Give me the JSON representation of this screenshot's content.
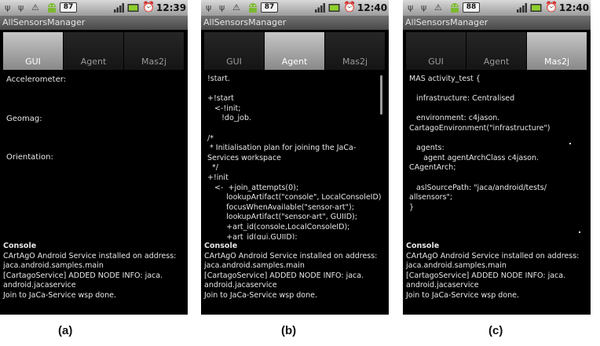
{
  "statusbars": [
    {
      "battery_badge": "87",
      "time": "12:39"
    },
    {
      "battery_badge": "87",
      "time": "12:40"
    },
    {
      "battery_badge": "88",
      "time": "12:40"
    }
  ],
  "icons": {
    "usb": "usb-icon",
    "usb_debug": "usb-debug-icon",
    "warning": "warning-icon",
    "android": "android-icon",
    "signal": "signal-icon",
    "battery": "battery-icon",
    "alarm": "alarm-icon"
  },
  "colors": {
    "tab_selected": "#a9a9a9",
    "tab_unselected": "#1e1e1e",
    "screen_bg": "#000000"
  },
  "app_title": "AllSensorsManager",
  "tabs": [
    "GUI",
    "Agent",
    "Mas2j"
  ],
  "selected_tabs": [
    "GUI",
    "Agent",
    "Mas2j"
  ],
  "gui": {
    "accelerometer": "Accelerometer:",
    "geomag": "Geomag:",
    "orientation": "Orientation:"
  },
  "agent_code": [
    "!start.",
    "",
    "+!start",
    "   <-!init;",
    "      !do_job.",
    "",
    "/*",
    " * Initialisation plan for joining the JaCa-",
    "Services workspace",
    "  */",
    "+!init",
    "   <-  +join_attempts(0);",
    "        lookupArtifact(\"console\", LocalConsoleID);",
    "        focusWhenAvailable(\"sensor-art\");",
    "        lookupArtifact(\"sensor-art\", GUIID);",
    "        +art_id(console,LocalConsoleID);",
    "        +art_id(gui,GUIID);"
  ],
  "mas2j_code": [
    "MAS activity_test {",
    "",
    "   infrastructure: Centralised",
    "",
    "   environment: c4jason.",
    "CartagoEnvironment(\"infrastructure\")",
    "",
    "   agents:",
    "      agent agentArchClass c4jason.",
    "CAgentArch;",
    "",
    "   aslSourcePath: \"jaca/android/tests/",
    "allsensors\";",
    "}"
  ],
  "console": {
    "title": "Console",
    "lines": [
      "CArtAgO Android Service installed on address:",
      "jaca.android.samples.main",
      "[CartagoService] ADDED NODE INFO: jaca.",
      "android.jacaservice",
      "Join to JaCa-Service wsp done."
    ]
  },
  "captions": [
    "(a)",
    "(b)",
    "(c)"
  ]
}
